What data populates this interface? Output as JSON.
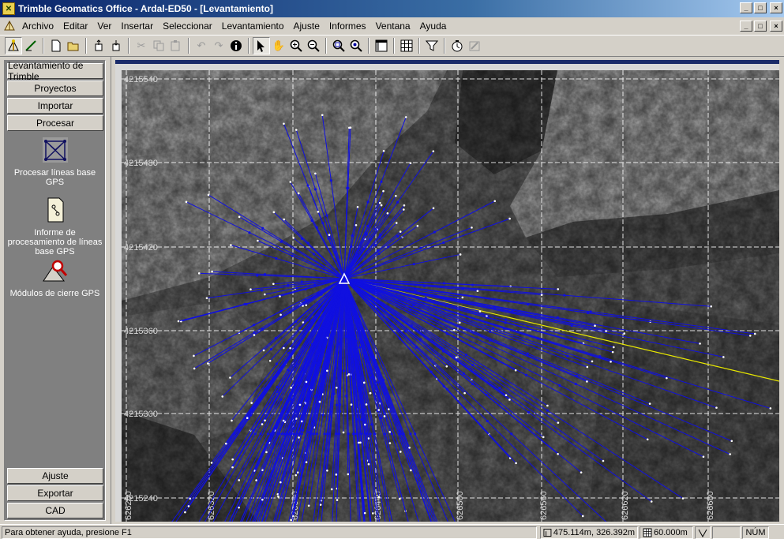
{
  "window": {
    "title": "Trimble Geomatics Office - Ardal-ED50 - [Levantamiento]",
    "controls": [
      "_",
      "□",
      "×"
    ]
  },
  "menubar": {
    "items": [
      "Archivo",
      "Editar",
      "Ver",
      "Insertar",
      "Seleccionar",
      "Levantamiento",
      "Ajuste",
      "Informes",
      "Ventana",
      "Ayuda"
    ]
  },
  "toolbar": {
    "buttons": [
      "survey-view-icon",
      "edit-icon",
      "new-file-icon",
      "open-folder-icon",
      "import-icon",
      "export-icon",
      "cut-icon",
      "copy-icon",
      "paste-icon",
      "undo-icon",
      "redo-icon",
      "info-icon",
      "select-arrow-icon",
      "pan-hand-icon",
      "zoom-in-icon",
      "zoom-out-icon",
      "zoom-window-icon",
      "zoom-extents-icon",
      "layout-icon",
      "grid-icon",
      "filter-icon",
      "timer-icon",
      "settings-icon"
    ]
  },
  "leftpanel": {
    "top_buttons": [
      "Levantamiento de Trimble",
      "Proyectos",
      "Importar",
      "Procesar"
    ],
    "tools": [
      {
        "label": "Procesar líneas base GPS",
        "icon": "baseline-network-icon"
      },
      {
        "label": "Informe de procesamiento de líneas base GPS",
        "icon": "report-icon"
      },
      {
        "label": "Módulos de cierre GPS",
        "icon": "loop-closure-icon"
      }
    ],
    "bottom_buttons": [
      "Ajuste",
      "Exportar",
      "CAD"
    ]
  },
  "map": {
    "north_labels": [
      "4215540",
      "4215480",
      "4215420",
      "4215360",
      "4215300",
      "4215240"
    ],
    "east_labels": [
      "626260",
      "626320",
      "626380",
      "626440",
      "626500",
      "626560",
      "626620",
      "626680"
    ],
    "colors": {
      "vector": "#1010e0",
      "point": "#ffffff",
      "reference_line": "#e8e800",
      "grid": "#ffffff"
    }
  },
  "statusbar": {
    "help": "Para obtener ayuda, presione F1",
    "coords": "475.114m, 326.392m",
    "scale": "60.000m",
    "mode": "NÚM"
  }
}
